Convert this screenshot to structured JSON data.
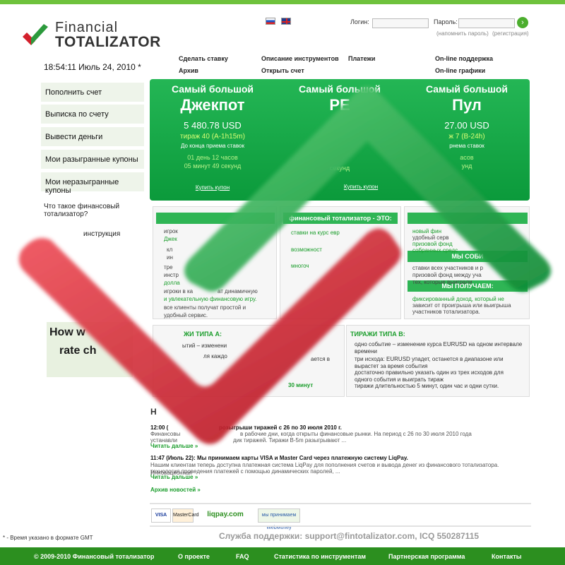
{
  "header": {
    "logo_line1": "Financial",
    "logo_line2": "TOTALIZATOR",
    "login_label": "Логин:",
    "password_label": "Пароль:",
    "remember": "(напомнить пароль)",
    "register": "(регистрация)"
  },
  "clock": "18:54:11 Июль 24, 2010 *",
  "topnav": [
    "Сделать ставку",
    "Описание инструментов",
    "Платежи",
    "On-line поддержка",
    "Архив",
    "Открыть счет",
    "On-line графики"
  ],
  "sidebar": {
    "items": [
      "Пополнить счет",
      "Выписка по счету",
      "Вывести деньги",
      "Мои разыгранные купоны",
      "Мои неразыгранные купоны"
    ],
    "links": [
      "Что такое финансовый",
      "тотализатор?",
      "инструкция"
    ]
  },
  "hero": {
    "cols": [
      {
        "t1": "Самый большой",
        "t2": "Джекпот",
        "value": "5 480.78 USD",
        "draw": "тираж 40 (А-1h15m)",
        "until": "До конца приема ставок",
        "count1": "01 день 12 часов",
        "count2": "05 минут 49 секунд",
        "buy": "Купить купон"
      },
      {
        "t1": "Самый большой",
        "t2": "РЕ",
        "value": "",
        "draw": "",
        "until": "",
        "count1": "",
        "count2": "секунд",
        "buy": "Купить купон"
      },
      {
        "t1": "Самый большой",
        "t2": "Пул",
        "value": "27.00 USD",
        "draw": "ж 7 (В-24h)",
        "until": "рнема ставок",
        "count1": "асов",
        "count2": "унд",
        "buy": ""
      }
    ]
  },
  "box_mid": {
    "title": "финансовый тотализатор - ЭТО:",
    "items": [
      "ставки на курс евр",
      "возможност",
      "многоч"
    ]
  },
  "box_left": {
    "items": [
      "игрок",
      "Джек",
      "кл",
      "ин",
      "тре",
      "инстр",
      "долла",
      "игроки в ка",
      "и увлекательную финансовую игру.",
      "все клиенты получат простой и",
      "удобный сервис."
    ],
    "extra": [
      "ат динамичную"
    ]
  },
  "box_right": {
    "h1": "МЫ СОБИ",
    "h2": "МЫ ПОЛУЧАЕМ:",
    "items": [
      "новый фин",
      "удобный серв",
      "призовой фонд",
      "собранных средс"
    ],
    "items2": [
      "ставки всех участников и р",
      "призовой фонд между уча",
      "тех, которые выиграли"
    ],
    "items3": [
      "фиксированный доход, который не",
      "зависит от проигрыша или выигрыша",
      "участников тотализатора."
    ]
  },
  "tirazh": {
    "a_title": "ЖИ ТИПА А:",
    "b_title": "ТИРАЖИ ТИПА В:",
    "a_items": [
      "ытий – изменени",
      "ля каждо",
      "ается в",
      "30 минут"
    ],
    "b_items": [
      "одно событие – изменение курса EURUSD на одном интервале",
      "времени",
      "три исхода: EURUSD упадет, останется в диапазоне или",
      "вырастет за время события",
      "достаточно правильно указать один из трех исходов для",
      "одного события и выиграть тираж",
      "тиражи длительностью 5 минут, один час и одни сутки."
    ]
  },
  "news": {
    "h": "Н",
    "n1_time": "12:00 (",
    "n1_title": "розыгрыши тиражей с 26 по 30 июля 2010 г.",
    "n1_text": "Финансовы",
    "n1_text2": "в рабочие дни, когда открыты финансовые рынки. На период с 26 по 30 июля 2010 года",
    "n1_text3": "устанавли",
    "n1_text4": "дик тиражей. Тиражи В-5m разыгрывают ...",
    "more": "Читать дальше »",
    "n2_title": "11:47 (Июль 22): Мы принимаем карты VISA и Master Card через платежную систему LiqPay.",
    "n2_text": "Нашим клиентам теперь доступна платежная система LiqPay для пополнения счетов и вывода денег из финансового тотализатора. Инновационная",
    "n2_text2": "технология проведения платежей с помощью динамических паролей, ...",
    "archive": "Архив новостей »"
  },
  "payments": [
    "VISA",
    "MasterCard",
    "liqpay.com",
    "мы принимаем WebMoney"
  ],
  "thumb": {
    "line1": "How w",
    "line2": "rate ch"
  },
  "support": "Служба поддержки: support@fintotalizator.com, ICQ 550287115",
  "gmt": "* - Время указано в формате GMT",
  "footer": {
    "copy": "© 2009-2010 Финансовый тотализатор",
    "links": [
      "О проекте",
      "FAQ",
      "Статистика по инструментам",
      "Партнерская программа",
      "Контакты"
    ]
  },
  "colors": {
    "green": "#2fb555",
    "dark_green": "#2c8f1f",
    "red": "#d3202c"
  }
}
